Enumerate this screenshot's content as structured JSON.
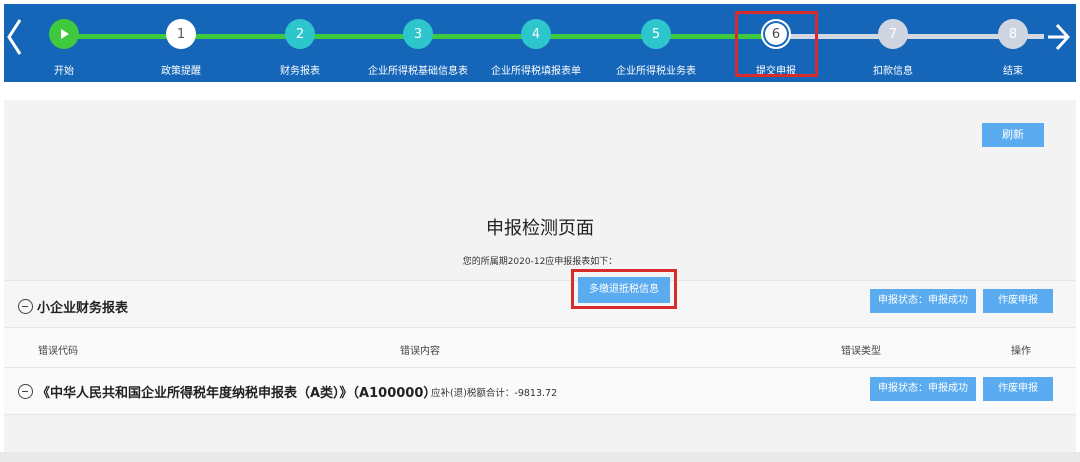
{
  "steps": [
    {
      "number": "",
      "label": "开始"
    },
    {
      "number": "1",
      "label": "政策提醒"
    },
    {
      "number": "2",
      "label": "财务报表"
    },
    {
      "number": "3",
      "label": "企业所得税基础信息表"
    },
    {
      "number": "4",
      "label": "企业所得税填报表单"
    },
    {
      "number": "5",
      "label": "企业所得税业务表"
    },
    {
      "number": "6",
      "label": "提交申报"
    },
    {
      "number": "7",
      "label": "扣款信息"
    },
    {
      "number": "8",
      "label": "结束"
    }
  ],
  "current_step": 6,
  "toolbar": {
    "refresh_label": "刷新"
  },
  "page": {
    "title": "申报检测页面",
    "period_text": "您的所属期2020-12应申报报表如下："
  },
  "section": {
    "title": "小企业财务报表",
    "status_label": "申报状态：申报成功",
    "void_label": "作废申报"
  },
  "table": {
    "headers": [
      "错误代码",
      "错误内容",
      "错误类型",
      "操作"
    ]
  },
  "report": {
    "name": "《中华人民共和国企业所得税年度纳税申报表（A类）》（A100000）",
    "amount_text": "应补(退)税额合计：-9813.72",
    "refund_button": "多缴退抵税信息",
    "status_label": "申报状态：申报成功",
    "void_label": "作废申报"
  },
  "colors": {
    "header_bg": "#1565b8",
    "progress_green": "#3fc93f",
    "step_teal": "#2cc6cc",
    "button_blue": "#5aabf0",
    "highlight_red": "#d82c2c"
  }
}
